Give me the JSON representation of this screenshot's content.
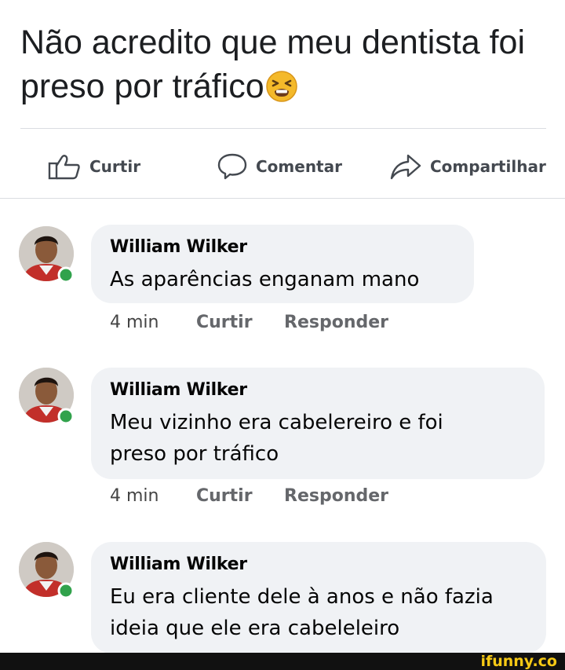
{
  "post": {
    "text": "Não acredito que meu dentista foi preso por tráfico",
    "emoji": "tired-face-emoji"
  },
  "actions": {
    "like_label": "Curtir",
    "comment_label": "Comentar",
    "share_label": "Compartilhar"
  },
  "comments": [
    {
      "author": "William Wilker",
      "text": "As aparências enganam mano",
      "time": "4 min",
      "like_label": "Curtir",
      "reply_label": "Responder"
    },
    {
      "author": "William Wilker",
      "line1": "Meu vizinho era cabelereiro e foi",
      "line2": "preso por tráfico",
      "time": "4 min",
      "like_label": "Curtir",
      "reply_label": "Responder"
    },
    {
      "author": "William Wilker",
      "line1": "Eu era cliente dele à anos e não fazia",
      "line2": "ideia que ele era cabeleleiro"
    }
  ],
  "watermark": "ifunny.co",
  "colors": {
    "bubble": "#f0f2f5",
    "online": "#31a24c",
    "meta": "#65676b",
    "watermark": "#f6c915"
  }
}
